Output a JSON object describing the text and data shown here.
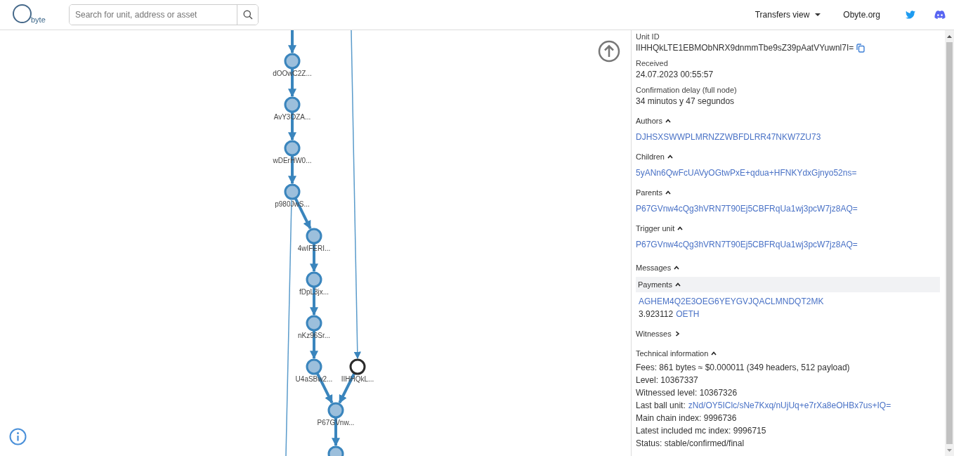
{
  "header": {
    "logo": "byte",
    "search": {
      "placeholder": "Search for unit, address or asset"
    },
    "nav": [
      {
        "kind": "dropdown",
        "label": "Transfers view"
      },
      {
        "kind": "link",
        "label": "Obyte.org"
      },
      {
        "kind": "twitter"
      },
      {
        "kind": "discord"
      }
    ]
  },
  "graph": {
    "nodes": [
      {
        "label": "dOOwC2Z...",
        "selected": false
      },
      {
        "label": "AvY3OZA...",
        "selected": false
      },
      {
        "label": "wDErHW0...",
        "selected": false
      },
      {
        "label": "p980JwS...",
        "selected": false
      },
      {
        "label": "4wIFERI...",
        "selected": false
      },
      {
        "label": "fDpL3jx...",
        "selected": false
      },
      {
        "label": "nKz96Sr...",
        "selected": false
      },
      {
        "label": "U4aSBw2...",
        "selected": false
      },
      {
        "label": "IIHHQkL...",
        "selected": true
      },
      {
        "label": "P67GVnw...",
        "selected": false
      },
      {
        "selected": false
      }
    ]
  },
  "details": {
    "fields": [
      {
        "label": "Unit ID",
        "value": "IIHHQkLTE1EBMObNRX9dnmmTbe9sZ39pAatVYuwnl7I=",
        "copy": true
      },
      {
        "label": "Received",
        "value": "24.07.2023 00:55:57",
        "copy": false
      },
      {
        "label": "Confirmation delay (full node)",
        "value": "34 minutos y 47 segundos",
        "copy": false
      }
    ],
    "sections": [
      {
        "title": "Authors",
        "expanded": true,
        "links": [
          "DJHSXSWWPLMRNZZWBFDLRR47NKW7ZU73"
        ]
      },
      {
        "title": "Children",
        "expanded": true,
        "links": [
          "5yANn6QwFcUAVyOGtwPxE+qdua+HFNKYdxGjnyo52ns="
        ]
      },
      {
        "title": "Parents",
        "expanded": true,
        "links": [
          "P67GVnw4cQg3hVRN7T90Ej5CBFRqUa1wj3pcW7jz8AQ="
        ]
      },
      {
        "title": "Trigger unit",
        "expanded": true,
        "links": [
          "P67GVnw4cQg3hVRN7T90Ej5CBFRqUa1wj3pcW7jz8AQ="
        ]
      }
    ],
    "messages": {
      "title": "Messages",
      "expanded": true,
      "payments": {
        "title": "Payments",
        "expanded": true,
        "address": "AGHEM4Q2E3OEG6YEYGVJQACLMNDQT2MK",
        "amount": "3.923112",
        "asset": "OETH"
      }
    },
    "witnesses": {
      "title": "Witnesses",
      "expanded": false
    },
    "technical": {
      "title": "Technical information",
      "expanded": true,
      "lines": [
        {
          "kind": "text",
          "label": "Fees:",
          "value": "861 bytes ≈ $0.000011 (349 headers, 512 payload)"
        },
        {
          "kind": "text",
          "label": "Level:",
          "value": "10367337"
        },
        {
          "kind": "text",
          "label": "Witnessed level:",
          "value": "10367326"
        },
        {
          "kind": "link",
          "label": "Last ball unit:",
          "value": "zNd/OY5IClc/sNe7Kxq/nUjUq+e7rXa8eOHBx7us+IQ="
        },
        {
          "kind": "text",
          "label": "Main chain index:",
          "value": "9996736"
        },
        {
          "kind": "text",
          "label": "Latest included mc index:",
          "value": "9996715"
        },
        {
          "kind": "text",
          "label": "Status:",
          "value": "stable/confirmed/final"
        }
      ]
    }
  }
}
